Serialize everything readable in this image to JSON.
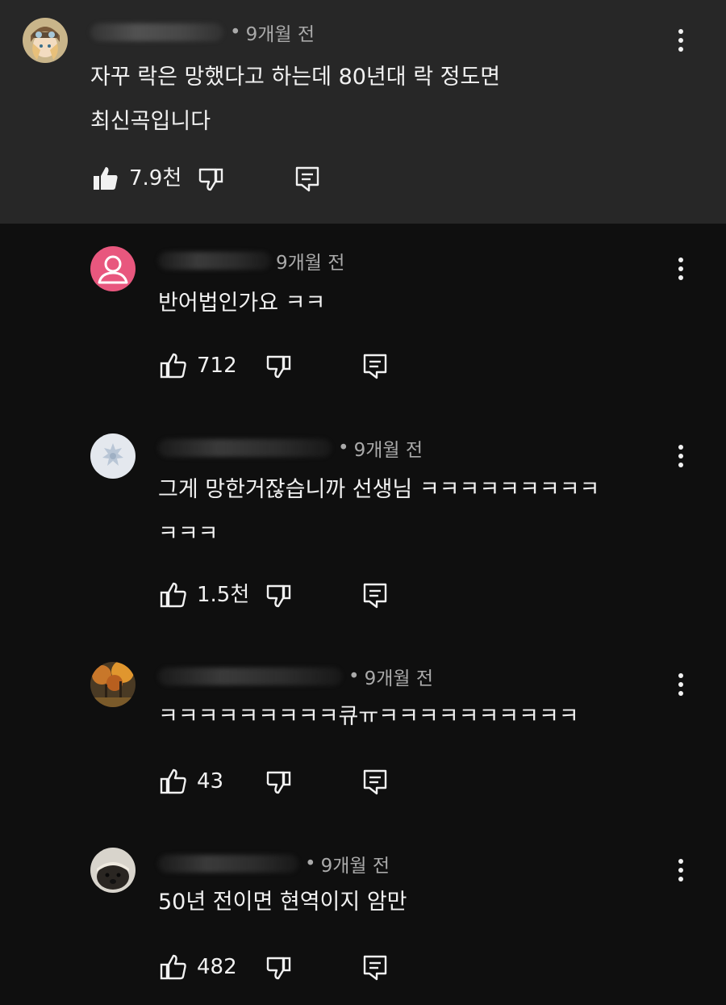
{
  "comments": [
    {
      "time": "9개월 전",
      "lines": [
        "자꾸 락은 망했다고 하는데 80년대 락 정도면",
        "최신곡입니다"
      ],
      "likes": "7.9천",
      "liked": true
    },
    {
      "time": "9개월 전",
      "lines": [
        "반어법인가요 ㅋㅋ"
      ],
      "likes": "712",
      "liked": false
    },
    {
      "time": "9개월 전",
      "lines": [
        "그게 망한거잖습니까 선생님 ㅋㅋㅋㅋㅋㅋㅋㅋㅋ",
        "ㅋㅋㅋ"
      ],
      "likes": "1.5천",
      "liked": false
    },
    {
      "time": "9개월 전",
      "lines": [
        "ㅋㅋㅋㅋㅋㅋㅋㅋㅋ큐ㅠㅋㅋㅋㅋㅋㅋㅋㅋㅋㅋ"
      ],
      "likes": "43",
      "liked": false
    },
    {
      "time": "9개월 전",
      "lines": [
        "50년 전이면 현역이지 암만"
      ],
      "likes": "482",
      "liked": false
    }
  ],
  "icons": {
    "like": "thumb-up-icon",
    "dislike": "thumb-down-icon",
    "reply": "reply-icon",
    "more": "more-vert-icon"
  },
  "colors": {
    "highlight_bg": "#272727",
    "page_bg": "#0f0f0f",
    "text": "#f1f1f1",
    "meta_text": "#aaaaaa",
    "default_avatar": "#e8577e"
  }
}
